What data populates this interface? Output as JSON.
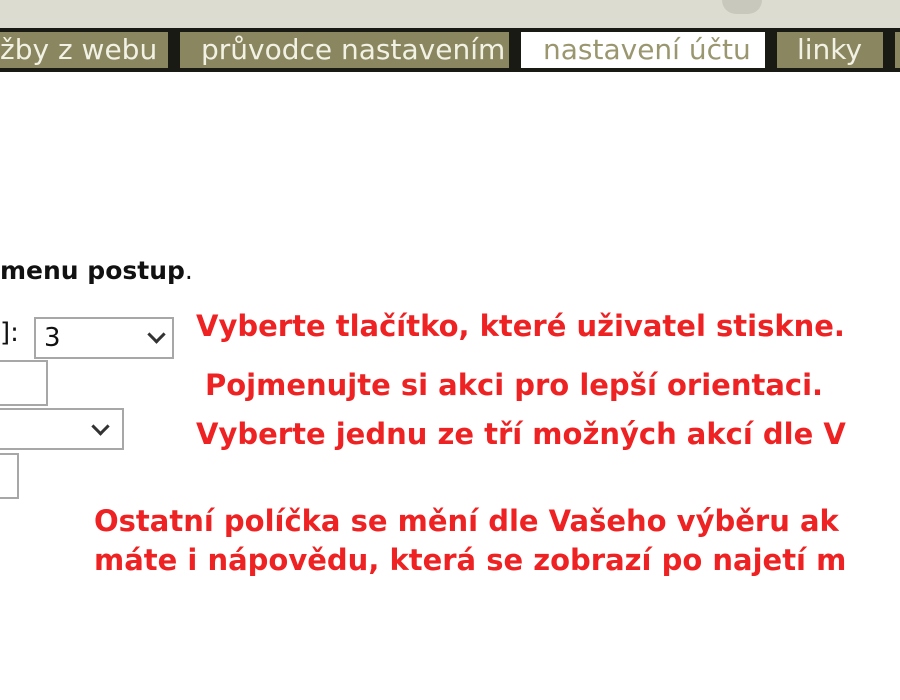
{
  "tabs": [
    {
      "label": "žby z webu",
      "active": false
    },
    {
      "label": "průvodce nastavením",
      "active": false
    },
    {
      "label": "nastavení účtu",
      "active": true
    },
    {
      "label": "linky",
      "active": false
    }
  ],
  "form": {
    "instruction_bold": "menu postup",
    "instruction_end": ".",
    "button_label_suffix": "]:",
    "button_select_value": "3",
    "action_select_value": ""
  },
  "hints": {
    "button": "Vyberte tlačítko, které uživatel stiskne.",
    "name": "Pojmenujte si akci pro lepší orientaci.",
    "action": "Vyberte jednu ze tří možných akcí dle V",
    "other_line1": "Ostatní políčka se mění dle Vašeho výběru ak",
    "other_line2": "máte i nápovědu, která se zobrazí po najetí m"
  },
  "colors": {
    "tab_bg": "#8a8660",
    "tab_active_text": "#9a9770",
    "hint_text": "#ee2222"
  }
}
